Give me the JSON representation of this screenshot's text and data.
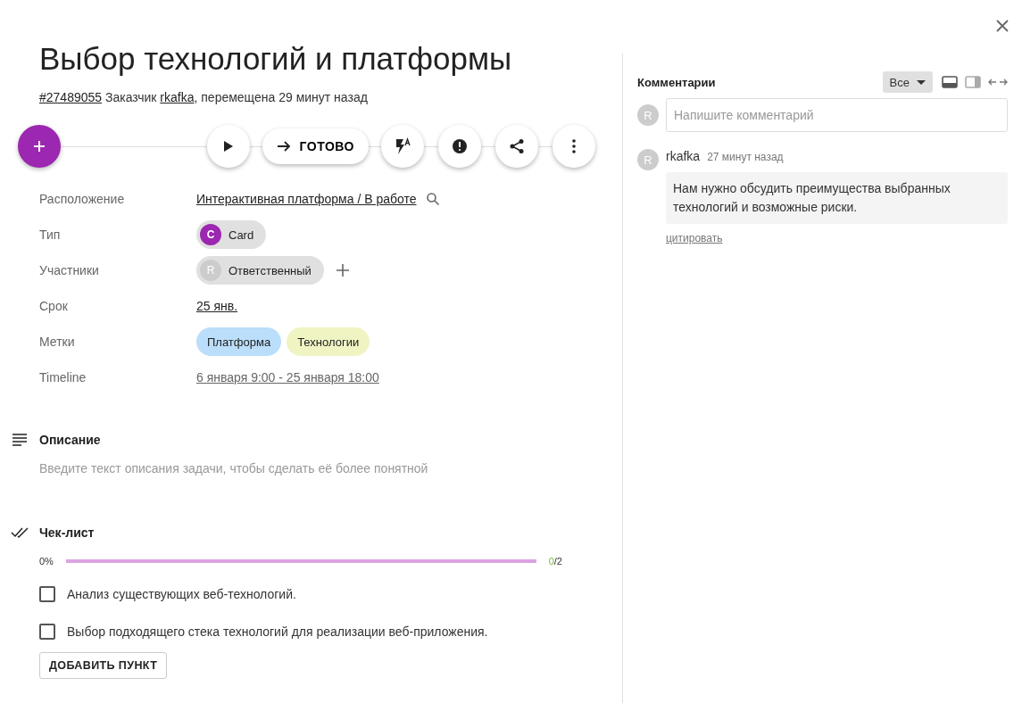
{
  "title": "Выбор технологий и платформы",
  "meta": [
    {
      "kind": "link",
      "text": "#27489055"
    },
    {
      "kind": "plain",
      "text": " Заказчик "
    },
    {
      "kind": "link",
      "text": "rkafka"
    },
    {
      "kind": "plain",
      "text": ", перемещена 29 минут назад"
    }
  ],
  "actions": [
    {
      "kind": "play"
    },
    {
      "kind": "move",
      "label": "ГОТОВО"
    },
    {
      "kind": "flash"
    },
    {
      "kind": "alert"
    },
    {
      "kind": "share"
    },
    {
      "kind": "more"
    }
  ],
  "fields": [
    {
      "label": "Расположение",
      "kind": "location",
      "value": "Интерактивная платформа / В работе"
    },
    {
      "label": "Тип",
      "kind": "type",
      "avatar": "C",
      "value": "Card",
      "color": "#9c27b0"
    },
    {
      "label": "Участники",
      "kind": "members",
      "avatar": "R",
      "value": "Ответственный"
    },
    {
      "label": "Срок",
      "kind": "date",
      "value": "25 янв."
    },
    {
      "label": "Метки",
      "kind": "tags",
      "tags": [
        {
          "text": "Платформа",
          "color": "#bbdefb"
        },
        {
          "text": "Технологии",
          "color": "#f0f4c3"
        }
      ]
    },
    {
      "label": "Timeline",
      "kind": "timeline",
      "value": "6 января 9:00 - 25 января 18:00"
    }
  ],
  "description": {
    "title": "Описание",
    "placeholder": "Введите текст описания задачи, чтобы сделать её более понятной"
  },
  "checklist": {
    "title": "Чек-лист",
    "percent": "0%",
    "level": 0,
    "done": "0",
    "total": "/2",
    "items": [
      {
        "text": "Анализ существующих веб-технологий.",
        "checked": false
      },
      {
        "text": "Выбор подходящего стека технологий для реализации веб-приложения.",
        "checked": false
      }
    ],
    "add_button": "ДОБАВИТЬ ПУНКТ"
  },
  "comments": {
    "title": "Комментарии",
    "filter": "Все",
    "avatar": "R",
    "placeholder": "Напишите комментарий",
    "items": [
      {
        "avatar": "R",
        "author": "rkafka",
        "time": "27 минут назад",
        "text": "Нам нужно обсудить преимущества выбранных технологий и возможные риски.",
        "action": "цитировать"
      }
    ]
  }
}
